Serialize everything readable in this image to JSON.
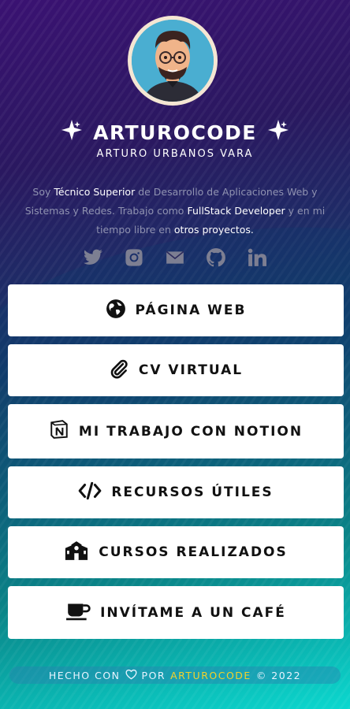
{
  "profile": {
    "brand": "ARTUROCODE",
    "full_name": "ARTURO URBANOS VARA",
    "bio_prefix": "Soy ",
    "bio_hl1": "Técnico Superior",
    "bio_mid1": " de Desarrollo de Aplicaciones Web y Sistemas y Redes. Trabajo como ",
    "bio_hl2": "FullStack Developer",
    "bio_mid2": " y en mi tiempo libre en ",
    "bio_hl3": "otros proyectos."
  },
  "socials": [
    "twitter-icon",
    "instagram-icon",
    "envelope-icon",
    "github-icon",
    "linkedin-icon"
  ],
  "buttons": [
    {
      "label": "PÁGINA WEB",
      "icon": "globe-icon"
    },
    {
      "label": "CV VIRTUAL",
      "icon": "paperclip-icon"
    },
    {
      "label": "MI TRABAJO CON NOTION",
      "icon": "notion-icon"
    },
    {
      "label": "RECURSOS ÚTILES",
      "icon": "code-icon"
    },
    {
      "label": "CURSOS REALIZADOS",
      "icon": "school-icon"
    },
    {
      "label": "INVÍTAME A UN CAFÉ",
      "icon": "coffee-icon"
    }
  ],
  "footer": {
    "made_with": "HECHO CON",
    "by": "POR",
    "author": "ARTUROCODE",
    "year": "© 2022"
  },
  "colors": {
    "accent_yellow": "#f2d22c",
    "bg_top": "#3a1272",
    "bg_bottom": "#0bd8cf"
  }
}
